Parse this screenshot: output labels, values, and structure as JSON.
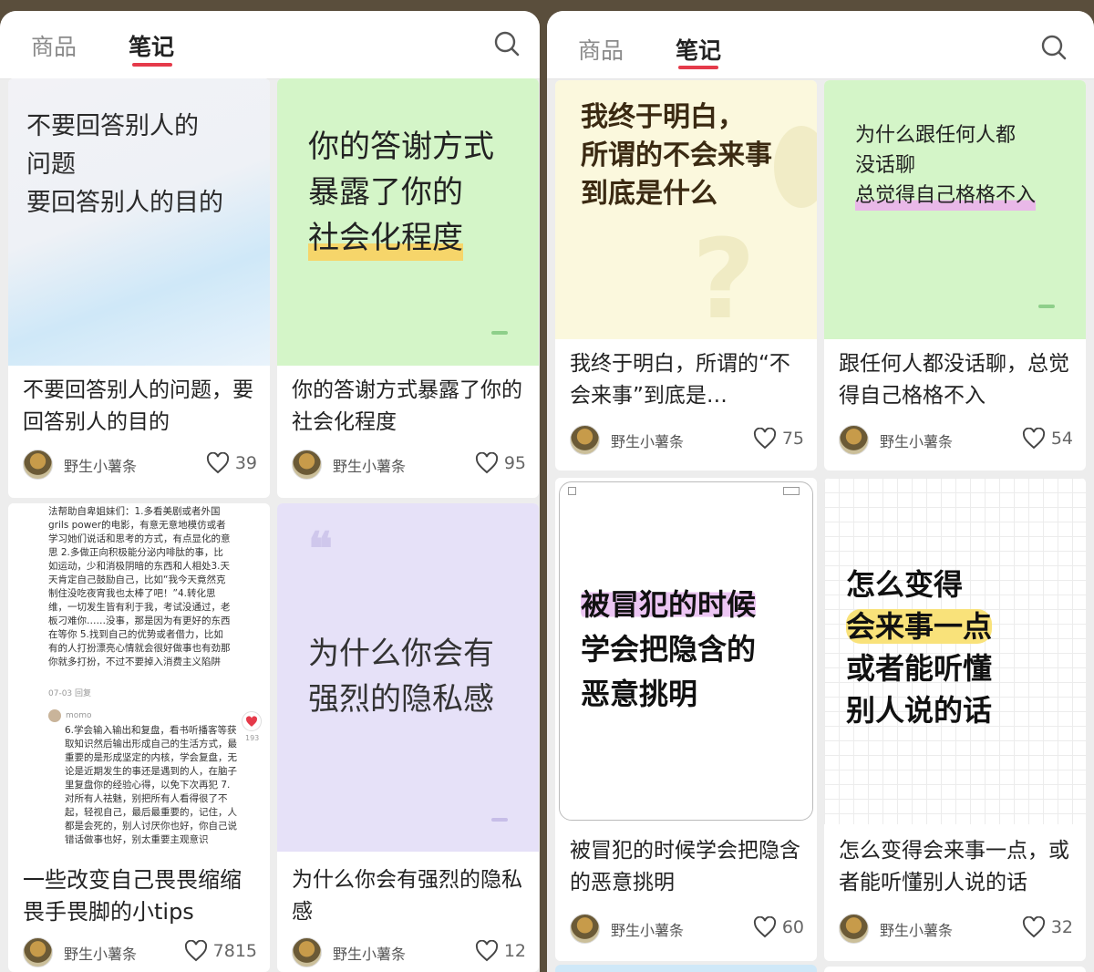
{
  "panels": [
    {
      "tabs": [
        "商品",
        "笔记"
      ],
      "cards": [
        {
          "cover": "不要回答别人的\n问题\n要回答别人的目的",
          "title": "不要回答别人的问题，要回答别人的目的",
          "author": "野生小薯条",
          "likes": "39"
        },
        {
          "cover_lines": [
            "你的答谢方式",
            "暴露了你的",
            "社会化程度"
          ],
          "title": "你的答谢方式暴露了你的社会化程度",
          "author": "野生小薯条",
          "likes": "95"
        },
        {
          "cover_comment_1": "法帮助自卑姐妹们：1.多看美剧或者外国grils power的电影，有意无意地模仿或者学习她们说话和思考的方式，有点显化的意思 2.多做正向积极能分泌内啡肽的事，比如运动，少和消极阴暗的东西和人相处3.天天肯定自己鼓励自己，比如“我今天竟然克制住没吃夜宵我也太棒了吧！”4.转化思维，一切发生皆有利于我，考试没通过，老板刁难你……没事，那是因为有更好的东西在等你 5.找到自己的优势或者借力，比如有的人打扮漂亮心情就会很好做事也有劲那你就多打扮，不过不要掉入消费主义陷阱",
          "cover_comment_meta": "07-03 回复",
          "cover_commenter": "momo",
          "cover_comment_2": "6.学会输入输出和复盘，看书听播客等获取知识然后输出形成自己的生活方式，最重要的是形成坚定的内核，学会复盘，无论是近期发生的事还是遇到的人，在脑子里复盘你的经验心得，以免下次再犯 7.对所有人祛魅，别把所有人看得很了不起，轻视自己，最后最重要的，记住，人都是会死的，别人讨厌你也好，你自己说错话做事也好，别太重要主观意识",
          "cover_comment_likes": "193",
          "title": "一些改变自己畏畏缩缩畏手畏脚的小tips",
          "author": "野生小薯条",
          "likes": "7815"
        },
        {
          "cover_quote": "❝",
          "cover_lines": [
            "为什么你会有",
            "强烈的隐私感"
          ],
          "title": "为什么你会有强烈的隐私感",
          "author": "野生小薯条",
          "likes": "12"
        }
      ]
    },
    {
      "tabs": [
        "商品",
        "笔记"
      ],
      "cards": [
        {
          "cover_lines": [
            "我终于明白，",
            "所谓的不会来事",
            "到底是什么"
          ],
          "title": "我终于明白，所谓的“不会来事”到底是…",
          "author": "野生小薯条",
          "likes": "75"
        },
        {
          "cover_lines": [
            "为什么跟任何人都",
            "没话聊",
            "总觉得自己格格不入"
          ],
          "title": "跟任何人都没话聊，总觉得自己格格不入",
          "author": "野生小薯条",
          "likes": "54"
        },
        {
          "cover_lines": [
            "被冒犯的时候",
            "学会把隐含的",
            "恶意挑明"
          ],
          "title": "被冒犯的时候学会把隐含的恶意挑明",
          "author": "野生小薯条",
          "likes": "60"
        },
        {
          "cover_lines": [
            "怎么变得",
            "会来事一点",
            "或者能听懂",
            "别人说的话"
          ],
          "title": "怎么变得会来事一点，或者能听懂别人说的话",
          "author": "野生小薯条",
          "likes": "32"
        }
      ]
    }
  ],
  "colors": {
    "accent": "#e53a4a",
    "green_cover": "#d4f5c8",
    "purple_cover": "#e6e1f8",
    "yellow_cover": "#fbf8dd"
  },
  "icons": {
    "search": "search-icon",
    "like": "heart-outline-icon",
    "avatar": "avatar"
  }
}
